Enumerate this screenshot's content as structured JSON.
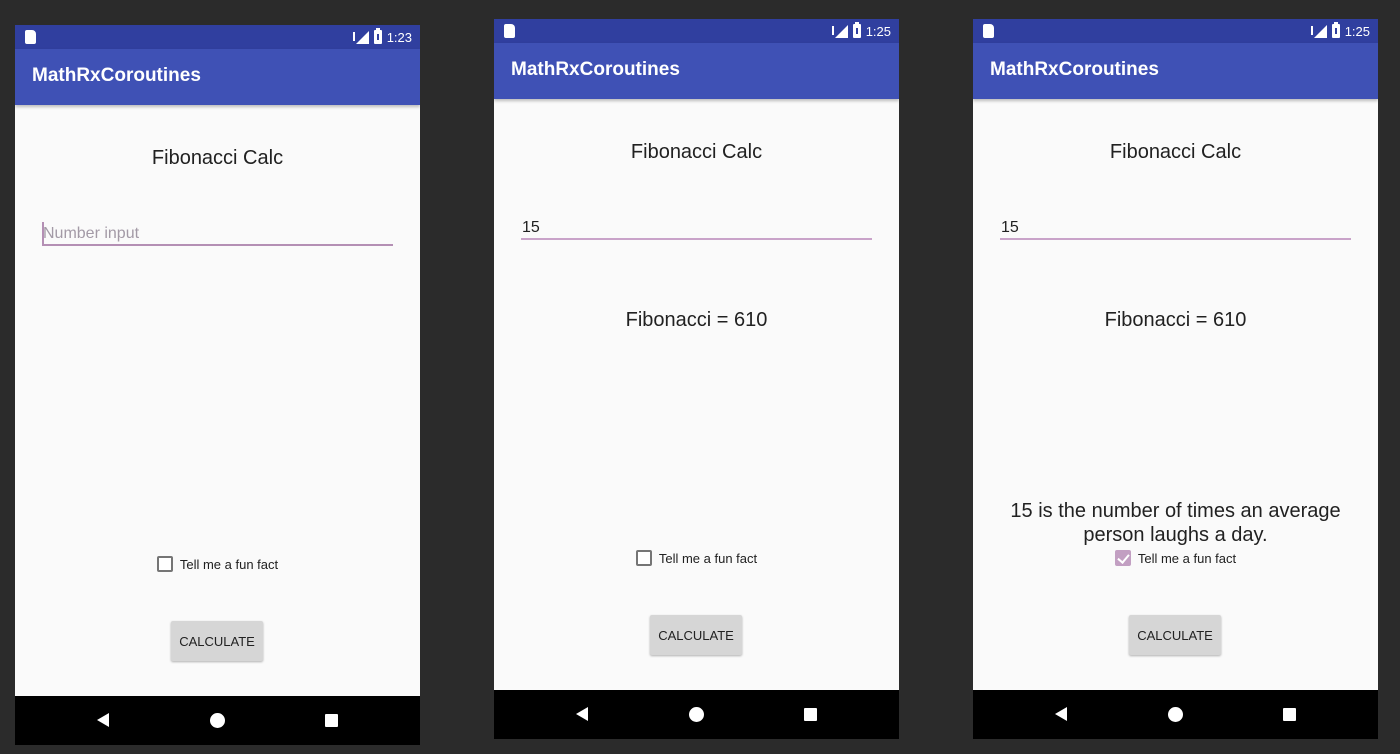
{
  "screens": [
    {
      "status": {
        "time": "1:23"
      },
      "app_title": "MathRxCoroutines",
      "heading": "Fibonacci Calc",
      "input": {
        "value": "",
        "placeholder": "Number input"
      },
      "result": "",
      "fun_fact": "",
      "checkbox": {
        "label": "Tell me a fun fact",
        "checked": false
      },
      "button_label": "CALCULATE"
    },
    {
      "status": {
        "time": "1:25"
      },
      "app_title": "MathRxCoroutines",
      "heading": "Fibonacci Calc",
      "input": {
        "value": "15",
        "placeholder": ""
      },
      "result": "Fibonacci = 610",
      "fun_fact": "",
      "checkbox": {
        "label": "Tell me a fun fact",
        "checked": false
      },
      "button_label": "CALCULATE"
    },
    {
      "status": {
        "time": "1:25"
      },
      "app_title": "MathRxCoroutines",
      "heading": "Fibonacci Calc",
      "input": {
        "value": "15",
        "placeholder": ""
      },
      "result": "Fibonacci = 610",
      "fun_fact": "15 is the number of times an average person laughs a day.",
      "checkbox": {
        "label": "Tell me a fun fact",
        "checked": true
      },
      "button_label": "CALCULATE"
    }
  ],
  "colors": {
    "status_bar": "#303f9f",
    "app_bar": "#3f51b5",
    "accent": "#c29fc2",
    "background": "#2b2b2b"
  },
  "icons": [
    "sd-card-icon",
    "signal-icon",
    "battery-icon",
    "back-icon",
    "home-icon",
    "recents-icon"
  ]
}
